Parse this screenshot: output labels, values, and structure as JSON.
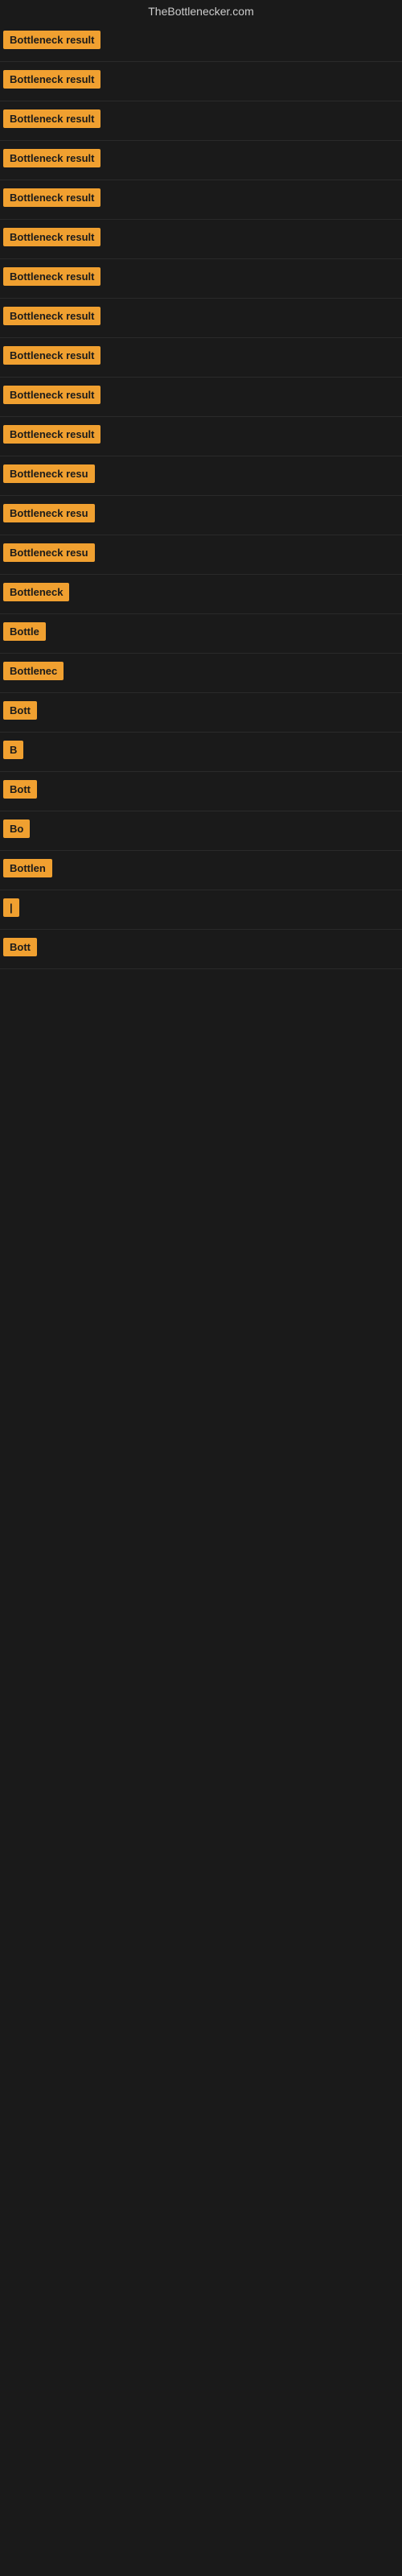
{
  "site": {
    "title": "TheBottlenecker.com"
  },
  "rows": [
    {
      "id": 1,
      "label": "Bottleneck result",
      "truncated": false
    },
    {
      "id": 2,
      "label": "Bottleneck result",
      "truncated": false
    },
    {
      "id": 3,
      "label": "Bottleneck result",
      "truncated": false
    },
    {
      "id": 4,
      "label": "Bottleneck result",
      "truncated": false
    },
    {
      "id": 5,
      "label": "Bottleneck result",
      "truncated": false
    },
    {
      "id": 6,
      "label": "Bottleneck result",
      "truncated": false
    },
    {
      "id": 7,
      "label": "Bottleneck result",
      "truncated": false
    },
    {
      "id": 8,
      "label": "Bottleneck result",
      "truncated": false
    },
    {
      "id": 9,
      "label": "Bottleneck result",
      "truncated": false
    },
    {
      "id": 10,
      "label": "Bottleneck result",
      "truncated": false
    },
    {
      "id": 11,
      "label": "Bottleneck result",
      "truncated": false
    },
    {
      "id": 12,
      "label": "Bottleneck resu",
      "truncated": true
    },
    {
      "id": 13,
      "label": "Bottleneck resu",
      "truncated": true
    },
    {
      "id": 14,
      "label": "Bottleneck resu",
      "truncated": true
    },
    {
      "id": 15,
      "label": "Bottleneck",
      "truncated": true
    },
    {
      "id": 16,
      "label": "Bottle",
      "truncated": true
    },
    {
      "id": 17,
      "label": "Bottlenec",
      "truncated": true
    },
    {
      "id": 18,
      "label": "Bott",
      "truncated": true
    },
    {
      "id": 19,
      "label": "B",
      "truncated": true
    },
    {
      "id": 20,
      "label": "Bott",
      "truncated": true
    },
    {
      "id": 21,
      "label": "Bo",
      "truncated": true
    },
    {
      "id": 22,
      "label": "Bottlen",
      "truncated": true
    },
    {
      "id": 23,
      "label": "|",
      "truncated": true
    },
    {
      "id": 24,
      "label": "Bott",
      "truncated": true
    }
  ]
}
